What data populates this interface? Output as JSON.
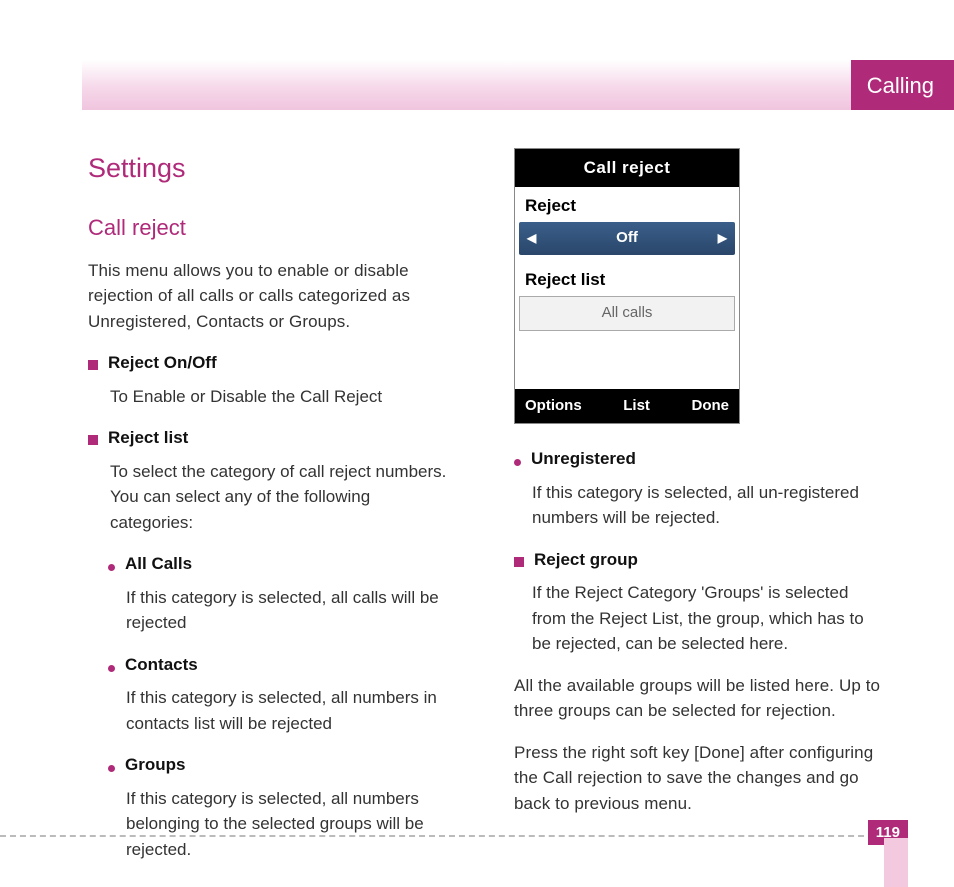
{
  "header": {
    "tab": "Calling"
  },
  "section_title": "Settings",
  "subsection_title": "Call reject",
  "intro": "This menu allows you to enable or disable rejection of all calls or calls categorized as Unregistered, Contacts or Groups.",
  "left_items": [
    {
      "bullet": "square",
      "title": "Reject On/Off",
      "desc": "To Enable or Disable the Call Reject"
    },
    {
      "bullet": "square",
      "title": "Reject list",
      "desc": "To select the category of  call reject numbers. You can select any of the following categories:",
      "subs": [
        {
          "title": "All Calls",
          "desc": "If this category is selected, all calls will be rejected"
        },
        {
          "title": "Contacts",
          "desc": "If this category is selected, all numbers in contacts list will be rejected"
        },
        {
          "title": "Groups",
          "desc": "If this category is selected, all numbers belonging to the selected groups will be rejected."
        }
      ]
    }
  ],
  "phone": {
    "title": "Call reject",
    "label1": "Reject",
    "selector_value": "Off",
    "label2": "Reject list",
    "input_value": "All calls",
    "soft_left": "Options",
    "soft_center": "List",
    "soft_right": "Done"
  },
  "right_items": [
    {
      "bullet": "dot",
      "title": "Unregistered",
      "desc": "If this category is selected, all un-registered numbers will be rejected."
    },
    {
      "bullet": "square",
      "title": "Reject group",
      "desc": "If the Reject Category 'Groups' is selected from the Reject List, the group, which has to be  rejected, can be selected here."
    }
  ],
  "closing": [
    "All the available groups will be listed here. Up to three groups can be selected for rejection.",
    "Press the right soft key [Done] after configuring the Call rejection to save the changes and go back to previous menu."
  ],
  "page_number": "119"
}
